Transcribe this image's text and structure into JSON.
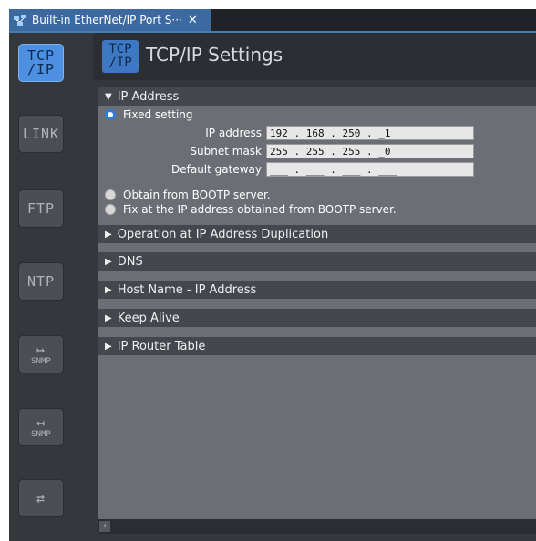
{
  "tab": {
    "title": "Built-in EtherNet/IP Port S···",
    "close": "✕"
  },
  "sidebar": {
    "items": [
      {
        "name": "tcpip",
        "line1": "TCP",
        "line2": "/IP",
        "active": true
      },
      {
        "name": "link",
        "line1": "LINK"
      },
      {
        "name": "ftp",
        "line1": "FTP"
      },
      {
        "name": "ntp",
        "line1": "NTP"
      },
      {
        "name": "snmp",
        "line1": "↦",
        "line2": "SNMP"
      },
      {
        "name": "snmp-trap",
        "line1": "↤",
        "line2": "SNMP"
      },
      {
        "name": "router",
        "line1": "⇄"
      }
    ]
  },
  "header": {
    "icon_line1": "TCP",
    "icon_line2": "/IP",
    "title": "TCP/IP Settings"
  },
  "sections": {
    "ip_address": "IP Address",
    "duplication": "Operation at IP Address Duplication",
    "dns": "DNS",
    "host_name": "Host Name - IP Address",
    "keep_alive": "Keep Alive",
    "router_table": "IP Router Table"
  },
  "ip": {
    "fixed_setting": "Fixed setting",
    "ip_address_label": "IP address",
    "ip_address_value": "192 . 168 . 250 . _1",
    "subnet_label": "Subnet mask",
    "subnet_value": "255 . 255 . 255 . _0",
    "gateway_label": "Default gateway",
    "gateway_value": "___ . ___ . ___ . ___",
    "bootp": "Obtain from BOOTP server.",
    "fix_bootp": "Fix at the IP address obtained from BOOTP server."
  },
  "arrows": {
    "expanded": "▼",
    "collapsed": "▶"
  },
  "scrollbar": {
    "left": "‹"
  },
  "colors": {
    "accent": "#4d8fe0",
    "background": "#34383d",
    "panel": "#6b6f75"
  }
}
